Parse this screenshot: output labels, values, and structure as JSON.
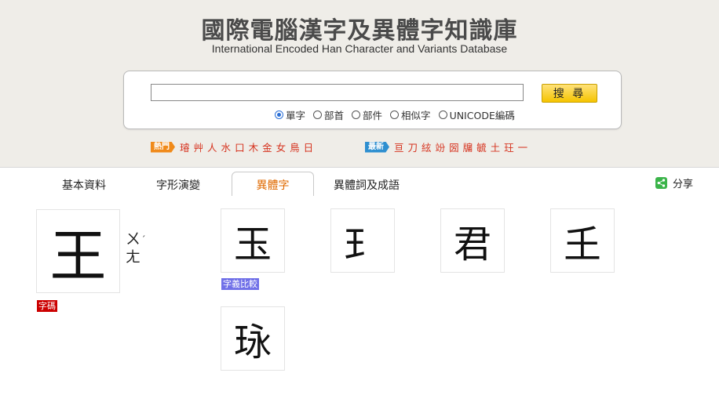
{
  "header": {
    "title": "國際電腦漢字及異體字知識庫",
    "subtitle": "International Encoded Han Character and Variants Database"
  },
  "search": {
    "value": "",
    "placeholder": "",
    "button_label": "搜 尋",
    "options": [
      {
        "label": "單字",
        "checked": true
      },
      {
        "label": "部首",
        "checked": false
      },
      {
        "label": "部件",
        "checked": false
      },
      {
        "label": "相似字",
        "checked": false
      },
      {
        "label": "UNICODE編碼",
        "checked": false
      }
    ]
  },
  "hot": {
    "badge": "熱門",
    "chars": [
      "璿",
      "艸",
      "人",
      "水",
      "口",
      "木",
      "金",
      "女",
      "鳥",
      "日"
    ]
  },
  "new": {
    "badge": "最新",
    "chars": [
      "亘",
      "刀",
      "絃",
      "竕",
      "圀",
      "牖",
      "毓",
      "土",
      "玨",
      "一"
    ]
  },
  "tabs": [
    {
      "label": "基本資料",
      "active": false
    },
    {
      "label": "字形演變",
      "active": false
    },
    {
      "label": "異體字",
      "active": true
    },
    {
      "label": "異體詞及成語",
      "active": false
    }
  ],
  "share": {
    "label": "分享",
    "icon": "share-icon"
  },
  "main_char": {
    "char": "王",
    "bopomofo": "ㄨㄤ",
    "tone": "ˊ",
    "badge": "字碼"
  },
  "variants": [
    "玉",
    "𤣩",
    "君",
    "𡈼",
    "𤤯"
  ],
  "compare_badge": "字義比較",
  "colors": {
    "accent": "#e06a00",
    "hot_badge": "#f08a1a",
    "new_badge": "#2e8fd0",
    "quick_char": "#d6331f",
    "code_badge": "#cc0000",
    "compare_badge": "#7070e8",
    "search_button": "#f5c400"
  }
}
